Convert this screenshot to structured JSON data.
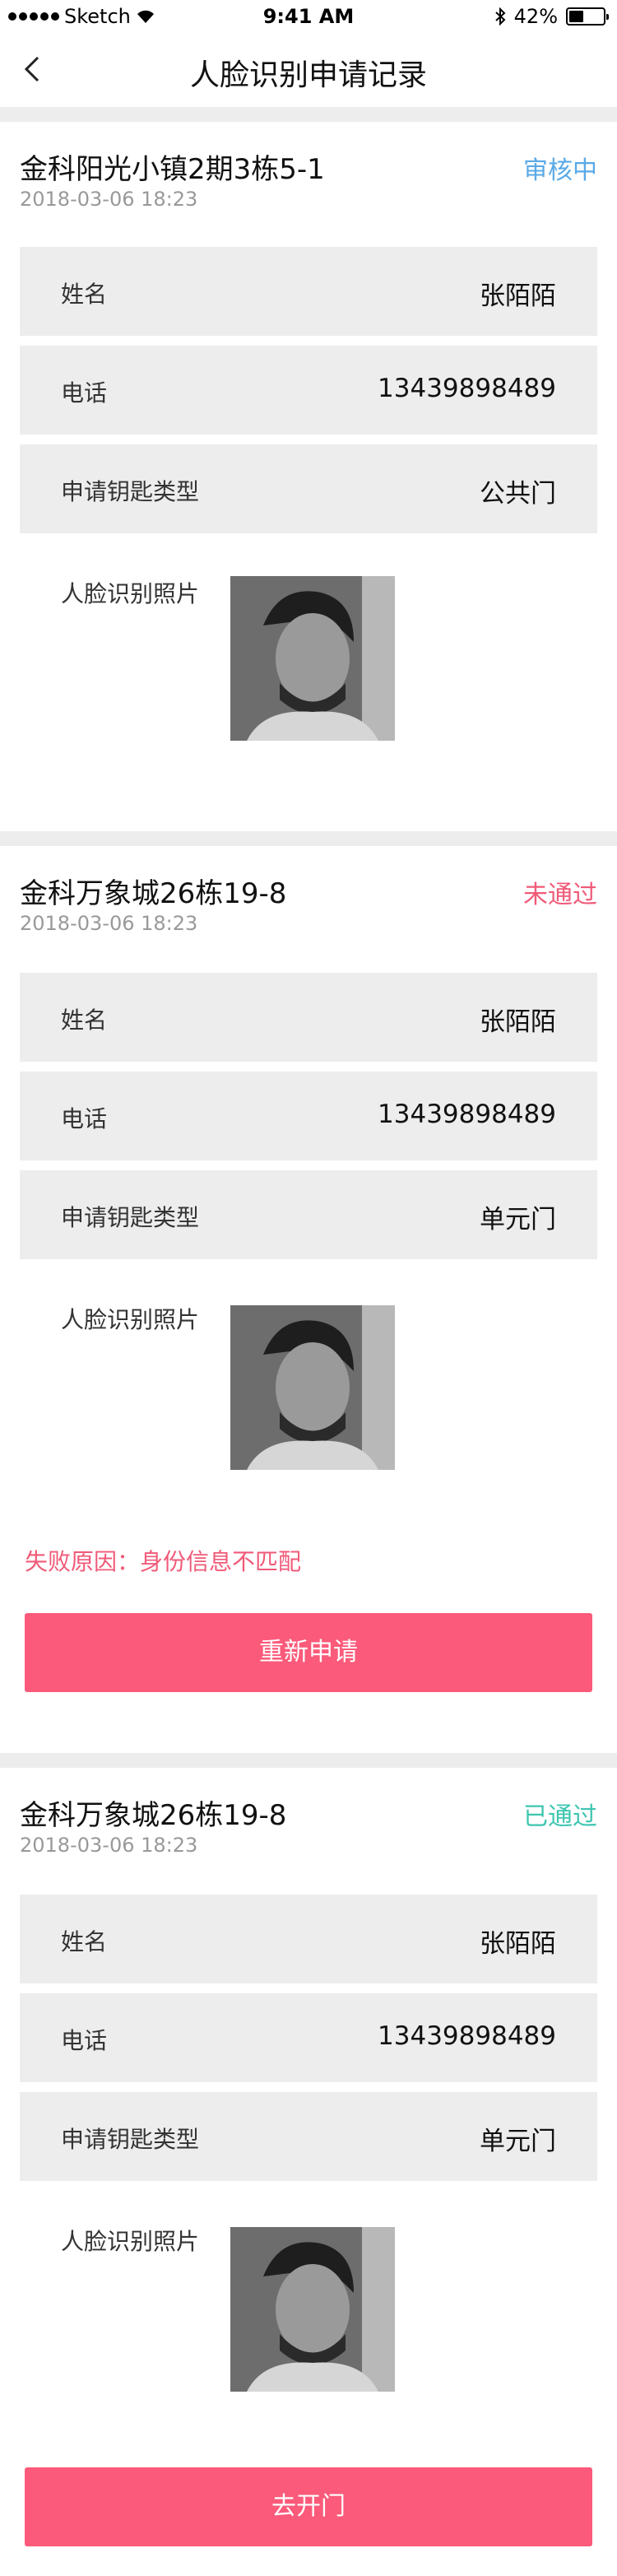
{
  "status_bar": {
    "carrier": "Sketch",
    "time": "9:41 AM",
    "battery": "42%",
    "battery_level": 0.42
  },
  "nav": {
    "title": "人脸识别申请记录"
  },
  "labels": {
    "name": "姓名",
    "phone": "电话",
    "key_type": "申请钥匙类型",
    "photo": "人脸识别照片"
  },
  "records": [
    {
      "address": "金科阳光小镇2期3栋5-1",
      "status": "审核中",
      "status_color": "#5aa9e6",
      "date": "2018-03-06 18:23",
      "name": "张陌陌",
      "phone": "13439898489",
      "key_type": "公共门"
    },
    {
      "address": "金科万象城26栋19-8",
      "status": "未通过",
      "status_color": "#f05a78",
      "date": "2018-03-06 18:23",
      "name": "张陌陌",
      "phone": "13439898489",
      "key_type": "单元门",
      "fail_reason": "失败原因：身份信息不匹配",
      "action": "重新申请"
    },
    {
      "address": "金科万象城26栋19-8",
      "status": "已通过",
      "status_color": "#3ec6b0",
      "date": "2018-03-06 18:23",
      "name": "张陌陌",
      "phone": "13439898489",
      "key_type": "单元门",
      "action": "去开门"
    }
  ]
}
